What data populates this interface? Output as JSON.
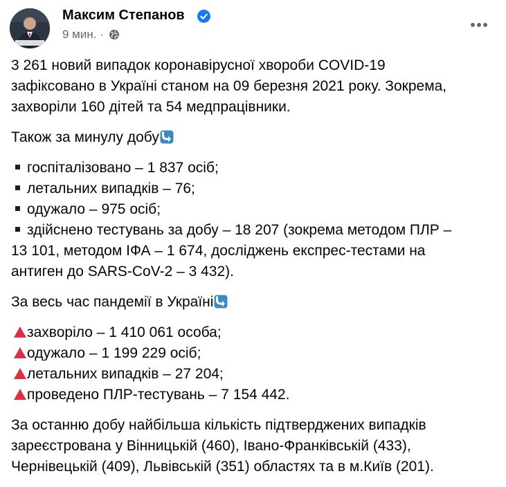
{
  "post": {
    "author": "Максим Степанов",
    "time": "9 мин.",
    "separator": "·",
    "paragraphs": {
      "intro": [
        "3 261 новий випадок коронавірусної хвороби COVID-19",
        "зафіксовано в Україні станом на 09 березня 2021 року. Зокрема,",
        "захворіли 160 дітей та 54 медпрацівники."
      ],
      "daily_heading": "Також за минулу добу",
      "daily_items": [
        "госпіталізовано – 1 837 осіб;",
        "летальних випадків – 76;",
        "одужало – 975 осіб;",
        "здійснено тестувань за добу – 18 207 (зокрема методом ПЛР –"
      ],
      "daily_continuation": [
        "13 101, методом ІФА – 1 674, досліджень експрес-тестами на",
        "антиген до SARS-CoV-2 – 3 432)."
      ],
      "total_heading": "За весь час пандемії в Україні",
      "total_items": [
        "захворіло – 1 410 061 особа;",
        "одужало – 1 199 229 осіб;",
        "летальних випадків – 27 204;",
        "проведено ПЛР-тестувань – 7 154 442."
      ],
      "regions": [
        "За останню добу найбільша кількість підтверджених випадків",
        "зареєстрована у Вінницькій (460), Івано-Франківській (433),",
        "Чернівецькій (409), Львівській (351) областях та в м.Київ (201)."
      ]
    }
  },
  "icons": {
    "verified": "verified-badge-icon",
    "privacy": "globe-icon",
    "more": "more-options-icon",
    "list_bullet": "black-square-icon",
    "heading_emoji": "down-arrow-emoji-icon",
    "total_bullet": "red-triangle-icon"
  },
  "colors": {
    "text": "#050505",
    "meta": "#65676b",
    "verified": "#1877f2",
    "triangle": "#dd2e44",
    "arrow_emoji": "#3b88c3"
  }
}
